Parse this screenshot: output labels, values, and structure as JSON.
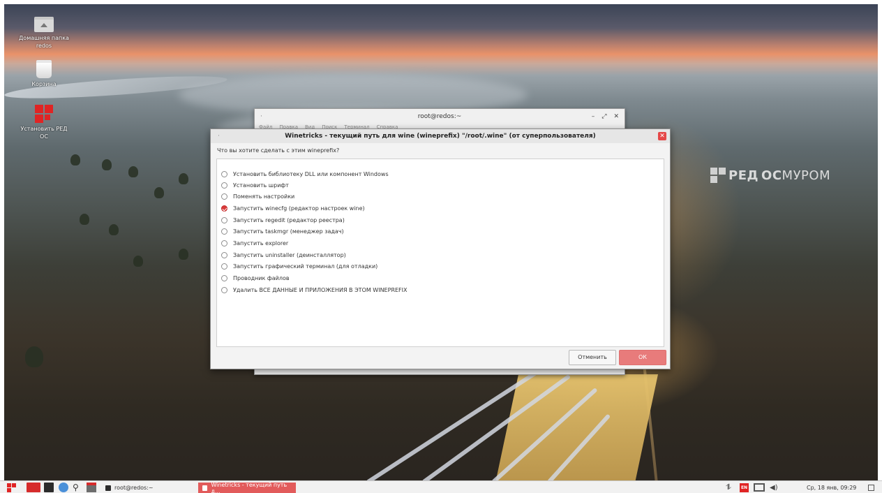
{
  "desktop": {
    "icons": [
      {
        "label_line1": "Домашняя папка",
        "label_line2": "redos",
        "icon": "home-folder-icon"
      },
      {
        "label": "Корзина",
        "icon": "trash-icon"
      },
      {
        "label": "Установить РЕД ОС",
        "icon": "redos-install-icon"
      }
    ],
    "watermark": {
      "part1": "РЕД",
      "part2": "ОС",
      "part3": "МУРОМ"
    }
  },
  "terminal": {
    "title": "root@redos:~",
    "controls": [
      "–",
      "⤢",
      "✕"
    ],
    "menu": [
      "Файл",
      "Правка",
      "Вид",
      "Поиск",
      "Терминал",
      "Справка"
    ]
  },
  "dialog": {
    "title": "Winetricks - текущий путь для wine (wineprefix) \"/root/.wine\" (от суперпользователя)",
    "question": "Что вы хотите сделать с этим wineprefix?",
    "options": [
      {
        "label": "Установить библиотеку DLL или компонент Windows",
        "checked": false
      },
      {
        "label": "Установить шрифт",
        "checked": false
      },
      {
        "label": "Поменять настройки",
        "checked": false
      },
      {
        "label": "Запустить winecfg (редактор настроек wine)",
        "checked": true
      },
      {
        "label": "Запустить regedit (редактор реестра)",
        "checked": false
      },
      {
        "label": "Запустить taskmgr (менеджер задач)",
        "checked": false
      },
      {
        "label": "Запустить explorer",
        "checked": false
      },
      {
        "label": "Запустить uninstaller (деинсталлятор)",
        "checked": false
      },
      {
        "label": "Запустить графический терминал (для отладки)",
        "checked": false
      },
      {
        "label": "Проводник файлов",
        "checked": false
      },
      {
        "label": "Удалить ВСЕ ДАННЫЕ И ПРИЛОЖЕНИЯ В ЭТОМ WINEPREFIX",
        "checked": false
      }
    ],
    "cancel_label": "Отменить",
    "ok_label": "ОК",
    "close_glyph": "✕"
  },
  "taskbar": {
    "tasks": [
      {
        "label": "root@redos:~",
        "active": false
      },
      {
        "label": "Winetricks - текущий путь д...",
        "active": true
      }
    ],
    "language": "EN",
    "clock": "Ср, 18 янв, 09:29"
  },
  "colors": {
    "accent": "#e02424",
    "ok_button": "#e87b7b",
    "checked_radio": "#d93a3a"
  }
}
